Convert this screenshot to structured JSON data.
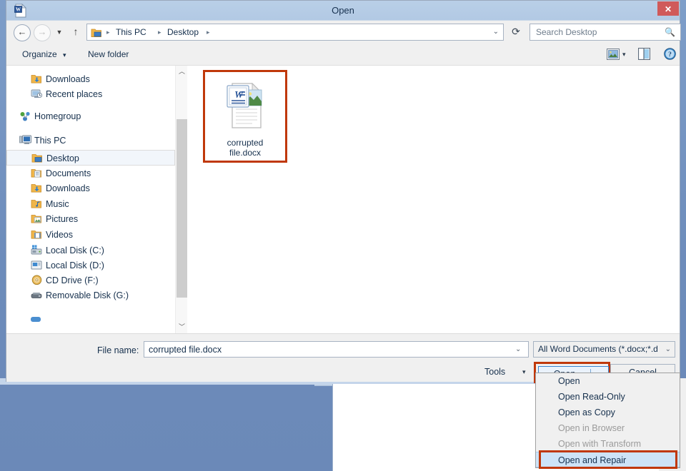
{
  "window": {
    "title": "Open",
    "icon": "word-document-icon",
    "close_label": "✕"
  },
  "nav": {
    "back_icon": "back-arrow-icon",
    "forward_icon": "forward-arrow-icon",
    "recent_icon": "chevron-down-icon",
    "up_icon": "up-arrow-icon",
    "refresh_icon": "refresh-icon",
    "address_chevron": "chevron-down-icon",
    "breadcrumbs": [
      "This PC",
      "Desktop"
    ],
    "separator": "▸"
  },
  "search": {
    "placeholder": "Search Desktop",
    "icon": "search-icon"
  },
  "toolbar": {
    "organize_label": "Organize",
    "organize_caret": "▾",
    "new_folder_label": "New folder",
    "view_icon": "view-layout-icon",
    "view_caret": "▾",
    "pane_icon": "preview-pane-icon",
    "help_icon": "help-icon"
  },
  "nav_pane": {
    "items": [
      {
        "label": "Downloads",
        "icon": "downloads-folder-icon",
        "indent": 34,
        "selected": false,
        "group": false
      },
      {
        "label": "Recent places",
        "icon": "recent-places-icon",
        "indent": 34,
        "selected": false,
        "group": false
      },
      {
        "label": "Homegroup",
        "icon": "homegroup-icon",
        "indent": 18,
        "selected": false,
        "group": true
      },
      {
        "label": "This PC",
        "icon": "this-pc-icon",
        "indent": 18,
        "selected": false,
        "group": true
      },
      {
        "label": "Desktop",
        "icon": "desktop-folder-icon",
        "indent": 34,
        "selected": true,
        "group": false
      },
      {
        "label": "Documents",
        "icon": "documents-folder-icon",
        "indent": 34,
        "selected": false,
        "group": false
      },
      {
        "label": "Downloads",
        "icon": "downloads-folder-icon",
        "indent": 34,
        "selected": false,
        "group": false
      },
      {
        "label": "Music",
        "icon": "music-folder-icon",
        "indent": 34,
        "selected": false,
        "group": false
      },
      {
        "label": "Pictures",
        "icon": "pictures-folder-icon",
        "indent": 34,
        "selected": false,
        "group": false
      },
      {
        "label": "Videos",
        "icon": "videos-folder-icon",
        "indent": 34,
        "selected": false,
        "group": false
      },
      {
        "label": "Local Disk (C:)",
        "icon": "local-disk-c-icon",
        "indent": 34,
        "selected": false,
        "group": false
      },
      {
        "label": "Local Disk (D:)",
        "icon": "local-disk-d-icon",
        "indent": 34,
        "selected": false,
        "group": false
      },
      {
        "label": "CD Drive (F:)",
        "icon": "cd-drive-icon",
        "indent": 34,
        "selected": false,
        "group": false
      },
      {
        "label": "Removable Disk (G:)",
        "icon": "removable-disk-icon",
        "indent": 34,
        "selected": false,
        "group": false
      }
    ],
    "scroll_up_icon": "chevron-up-icon",
    "scroll_down_icon": "chevron-down-icon"
  },
  "file_list": {
    "files": [
      {
        "name_line1": "corrupted",
        "name_line2": "file.docx",
        "icon": "word-document-icon",
        "highlighted": true
      }
    ]
  },
  "footer": {
    "filename_label": "File name:",
    "filename_value": "corrupted file.docx",
    "filename_chevron": "chevron-down-icon",
    "filetype_value": "All Word Documents (*.docx;*.d",
    "filetype_chevron": "chevron-down-icon",
    "tools_label": "Tools",
    "tools_caret": "▾",
    "open_label": "Open",
    "open_split_caret": "▾",
    "cancel_label": "Cancel"
  },
  "open_menu": {
    "items": [
      {
        "label": "Open",
        "disabled": false,
        "highlighted": false
      },
      {
        "label": "Open Read-Only",
        "disabled": false,
        "highlighted": false
      },
      {
        "label": "Open as Copy",
        "disabled": false,
        "highlighted": false
      },
      {
        "label": "Open in Browser",
        "disabled": true,
        "highlighted": false
      },
      {
        "label": "Open with Transform",
        "disabled": true,
        "highlighted": false
      },
      {
        "label": "Open and Repair",
        "disabled": false,
        "highlighted": true
      }
    ]
  },
  "colors": {
    "annotation": "#c0380a",
    "titlebar": "#b9cfe7",
    "close_button": "#d05a5a",
    "menu_highlight": "#cde3f7",
    "app_background": "#6d8cbb"
  }
}
